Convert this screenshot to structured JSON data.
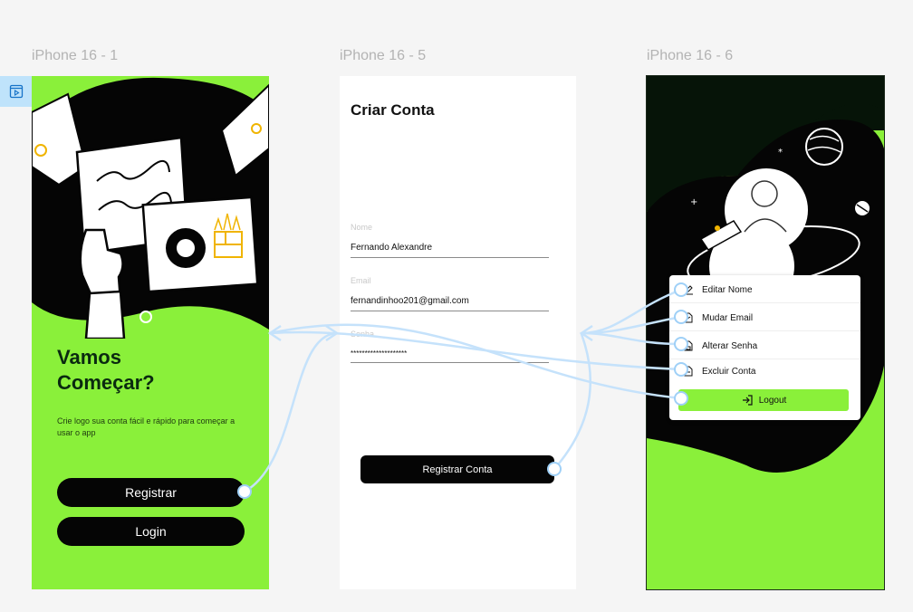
{
  "frames": {
    "f1_label": "iPhone 16 - 1",
    "f2_label": "iPhone 16 - 5",
    "f3_label": "iPhone 16 - 6"
  },
  "welcome": {
    "title_line1": "Vamos",
    "title_line2": "Começar?",
    "subtitle": "Crie logo sua conta fácil e rápido para começar a usar o app",
    "register_label": "Registrar",
    "login_label": "Login"
  },
  "signup": {
    "title": "Criar Conta",
    "name_label": "Nome",
    "name_value": "Fernando Alexandre",
    "email_label": "Email",
    "email_value": "fernandinhoo201@gmail.com",
    "password_label": "Senha",
    "password_value": "********************",
    "submit_label": "Registrar Conta"
  },
  "profile_menu": {
    "items": [
      {
        "label": "Editar Nome",
        "icon": "pencil-icon"
      },
      {
        "label": "Mudar Email",
        "icon": "file-edit-icon"
      },
      {
        "label": "Alterar Senha",
        "icon": "file-lock-icon"
      },
      {
        "label": "Excluir Conta",
        "icon": "file-delete-icon"
      }
    ],
    "logout_label": "Logout",
    "logout_icon": "login-arrow-icon"
  },
  "colors": {
    "accent_green": "#8af03a",
    "dark": "#050505",
    "prototype_wire": "#c5e2fb"
  }
}
